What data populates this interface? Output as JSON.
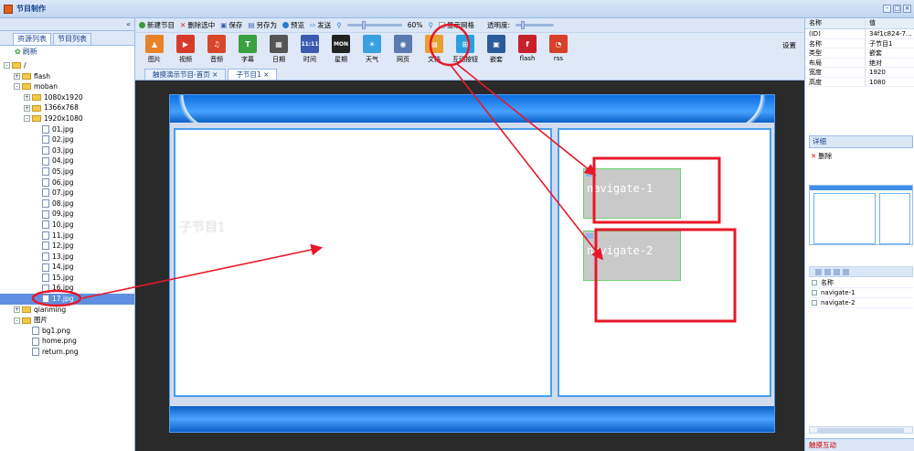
{
  "window": {
    "title": "节目制作",
    "btn_min": "-",
    "btn_max": "□",
    "btn_close": "×"
  },
  "left_panel": {
    "collapse": "«",
    "tabs": [
      "资源列表",
      "节目列表"
    ],
    "refresh": "刷新",
    "tree": [
      {
        "label": "/",
        "depth": 0,
        "kind": "folder",
        "toggle": "-"
      },
      {
        "label": "flash",
        "depth": 1,
        "kind": "folder",
        "toggle": "+"
      },
      {
        "label": "moban",
        "depth": 1,
        "kind": "folder",
        "toggle": "-"
      },
      {
        "label": "1080x1920",
        "depth": 2,
        "kind": "folder",
        "toggle": "+"
      },
      {
        "label": "1366x768",
        "depth": 2,
        "kind": "folder",
        "toggle": "+"
      },
      {
        "label": "1920x1080",
        "depth": 2,
        "kind": "folder",
        "toggle": "-"
      },
      {
        "label": "01.jpg",
        "depth": 3,
        "kind": "file"
      },
      {
        "label": "02.jpg",
        "depth": 3,
        "kind": "file"
      },
      {
        "label": "03.jpg",
        "depth": 3,
        "kind": "file"
      },
      {
        "label": "04.jpg",
        "depth": 3,
        "kind": "file"
      },
      {
        "label": "05.jpg",
        "depth": 3,
        "kind": "file"
      },
      {
        "label": "06.jpg",
        "depth": 3,
        "kind": "file"
      },
      {
        "label": "07.jpg",
        "depth": 3,
        "kind": "file"
      },
      {
        "label": "08.jpg",
        "depth": 3,
        "kind": "file"
      },
      {
        "label": "09.jpg",
        "depth": 3,
        "kind": "file"
      },
      {
        "label": "10.jpg",
        "depth": 3,
        "kind": "file"
      },
      {
        "label": "11.jpg",
        "depth": 3,
        "kind": "file"
      },
      {
        "label": "12.jpg",
        "depth": 3,
        "kind": "file"
      },
      {
        "label": "13.jpg",
        "depth": 3,
        "kind": "file"
      },
      {
        "label": "14.jpg",
        "depth": 3,
        "kind": "file"
      },
      {
        "label": "15.jpg",
        "depth": 3,
        "kind": "file"
      },
      {
        "label": "16.jpg",
        "depth": 3,
        "kind": "file"
      },
      {
        "label": "17.jpg",
        "depth": 3,
        "kind": "file",
        "selected": true
      },
      {
        "label": "qianming",
        "depth": 1,
        "kind": "folder",
        "toggle": "+"
      },
      {
        "label": "图片",
        "depth": 1,
        "kind": "folder",
        "toggle": "-"
      },
      {
        "label": "bg1.png",
        "depth": 2,
        "kind": "file"
      },
      {
        "label": "home.png",
        "depth": 2,
        "kind": "file"
      },
      {
        "label": "return.png",
        "depth": 2,
        "kind": "file"
      }
    ]
  },
  "toolbar": {
    "new": "新建节目",
    "delete": "删除选中",
    "save": "保存",
    "save_as": "另存为",
    "preview": "预览",
    "send": "发送",
    "zoom": "60%",
    "grid": "显示网格",
    "opacity": "透明度:",
    "settings": "设置"
  },
  "tools": [
    {
      "label": "图片",
      "color": "#e8822a",
      "glyph": "▲"
    },
    {
      "label": "视频",
      "color": "#d83a2a",
      "glyph": "▶"
    },
    {
      "label": "音频",
      "color": "#d8462a",
      "glyph": "♫"
    },
    {
      "label": "字幕",
      "color": "#3aa040",
      "glyph": "T"
    },
    {
      "label": "日期",
      "color": "#555555",
      "glyph": "▦"
    },
    {
      "label": "时间",
      "color": "#3a5ab0",
      "glyph": "11:11"
    },
    {
      "label": "星期",
      "color": "#222222",
      "glyph": "MON"
    },
    {
      "label": "天气",
      "color": "#3aa0e0",
      "glyph": "☀"
    },
    {
      "label": "网页",
      "color": "#5a7ab0",
      "glyph": "◉"
    },
    {
      "label": "文档",
      "color": "#e8a030",
      "glyph": "▤"
    },
    {
      "label": "互动按钮",
      "color": "#2aa0e0",
      "glyph": "⊞"
    },
    {
      "label": "嵌套",
      "color": "#2a5a9a",
      "glyph": "▣"
    },
    {
      "label": "flash",
      "color": "#c8202a",
      "glyph": "f"
    },
    {
      "label": "rss",
      "color": "#d8402a",
      "glyph": "◔"
    }
  ],
  "doc_tabs": [
    "触摸演示节目-首页",
    "子节目1"
  ],
  "doc_tab_close": "×",
  "canvas": {
    "zone_label": "子节目1",
    "nav1": "navigate-1",
    "nav2": "navigate-2"
  },
  "properties": {
    "col_name": "名称",
    "col_value": "值",
    "rows": [
      {
        "k": "(ID)",
        "v": "34f1c824-7..."
      },
      {
        "k": "名称",
        "v": "子节目1"
      },
      {
        "k": "类型",
        "v": "嵌套"
      },
      {
        "k": "布局",
        "v": "绝对"
      },
      {
        "k": "宽度",
        "v": "1920"
      },
      {
        "k": "高度",
        "v": "1080"
      }
    ]
  },
  "detail": {
    "title": "详细",
    "delete": "删除"
  },
  "element_list": {
    "header": "名称",
    "items": [
      "navigate-1",
      "navigate-2"
    ]
  },
  "status": "触摸互动",
  "colors": {
    "annotation": "#e8182a",
    "accent": "#15428b"
  }
}
